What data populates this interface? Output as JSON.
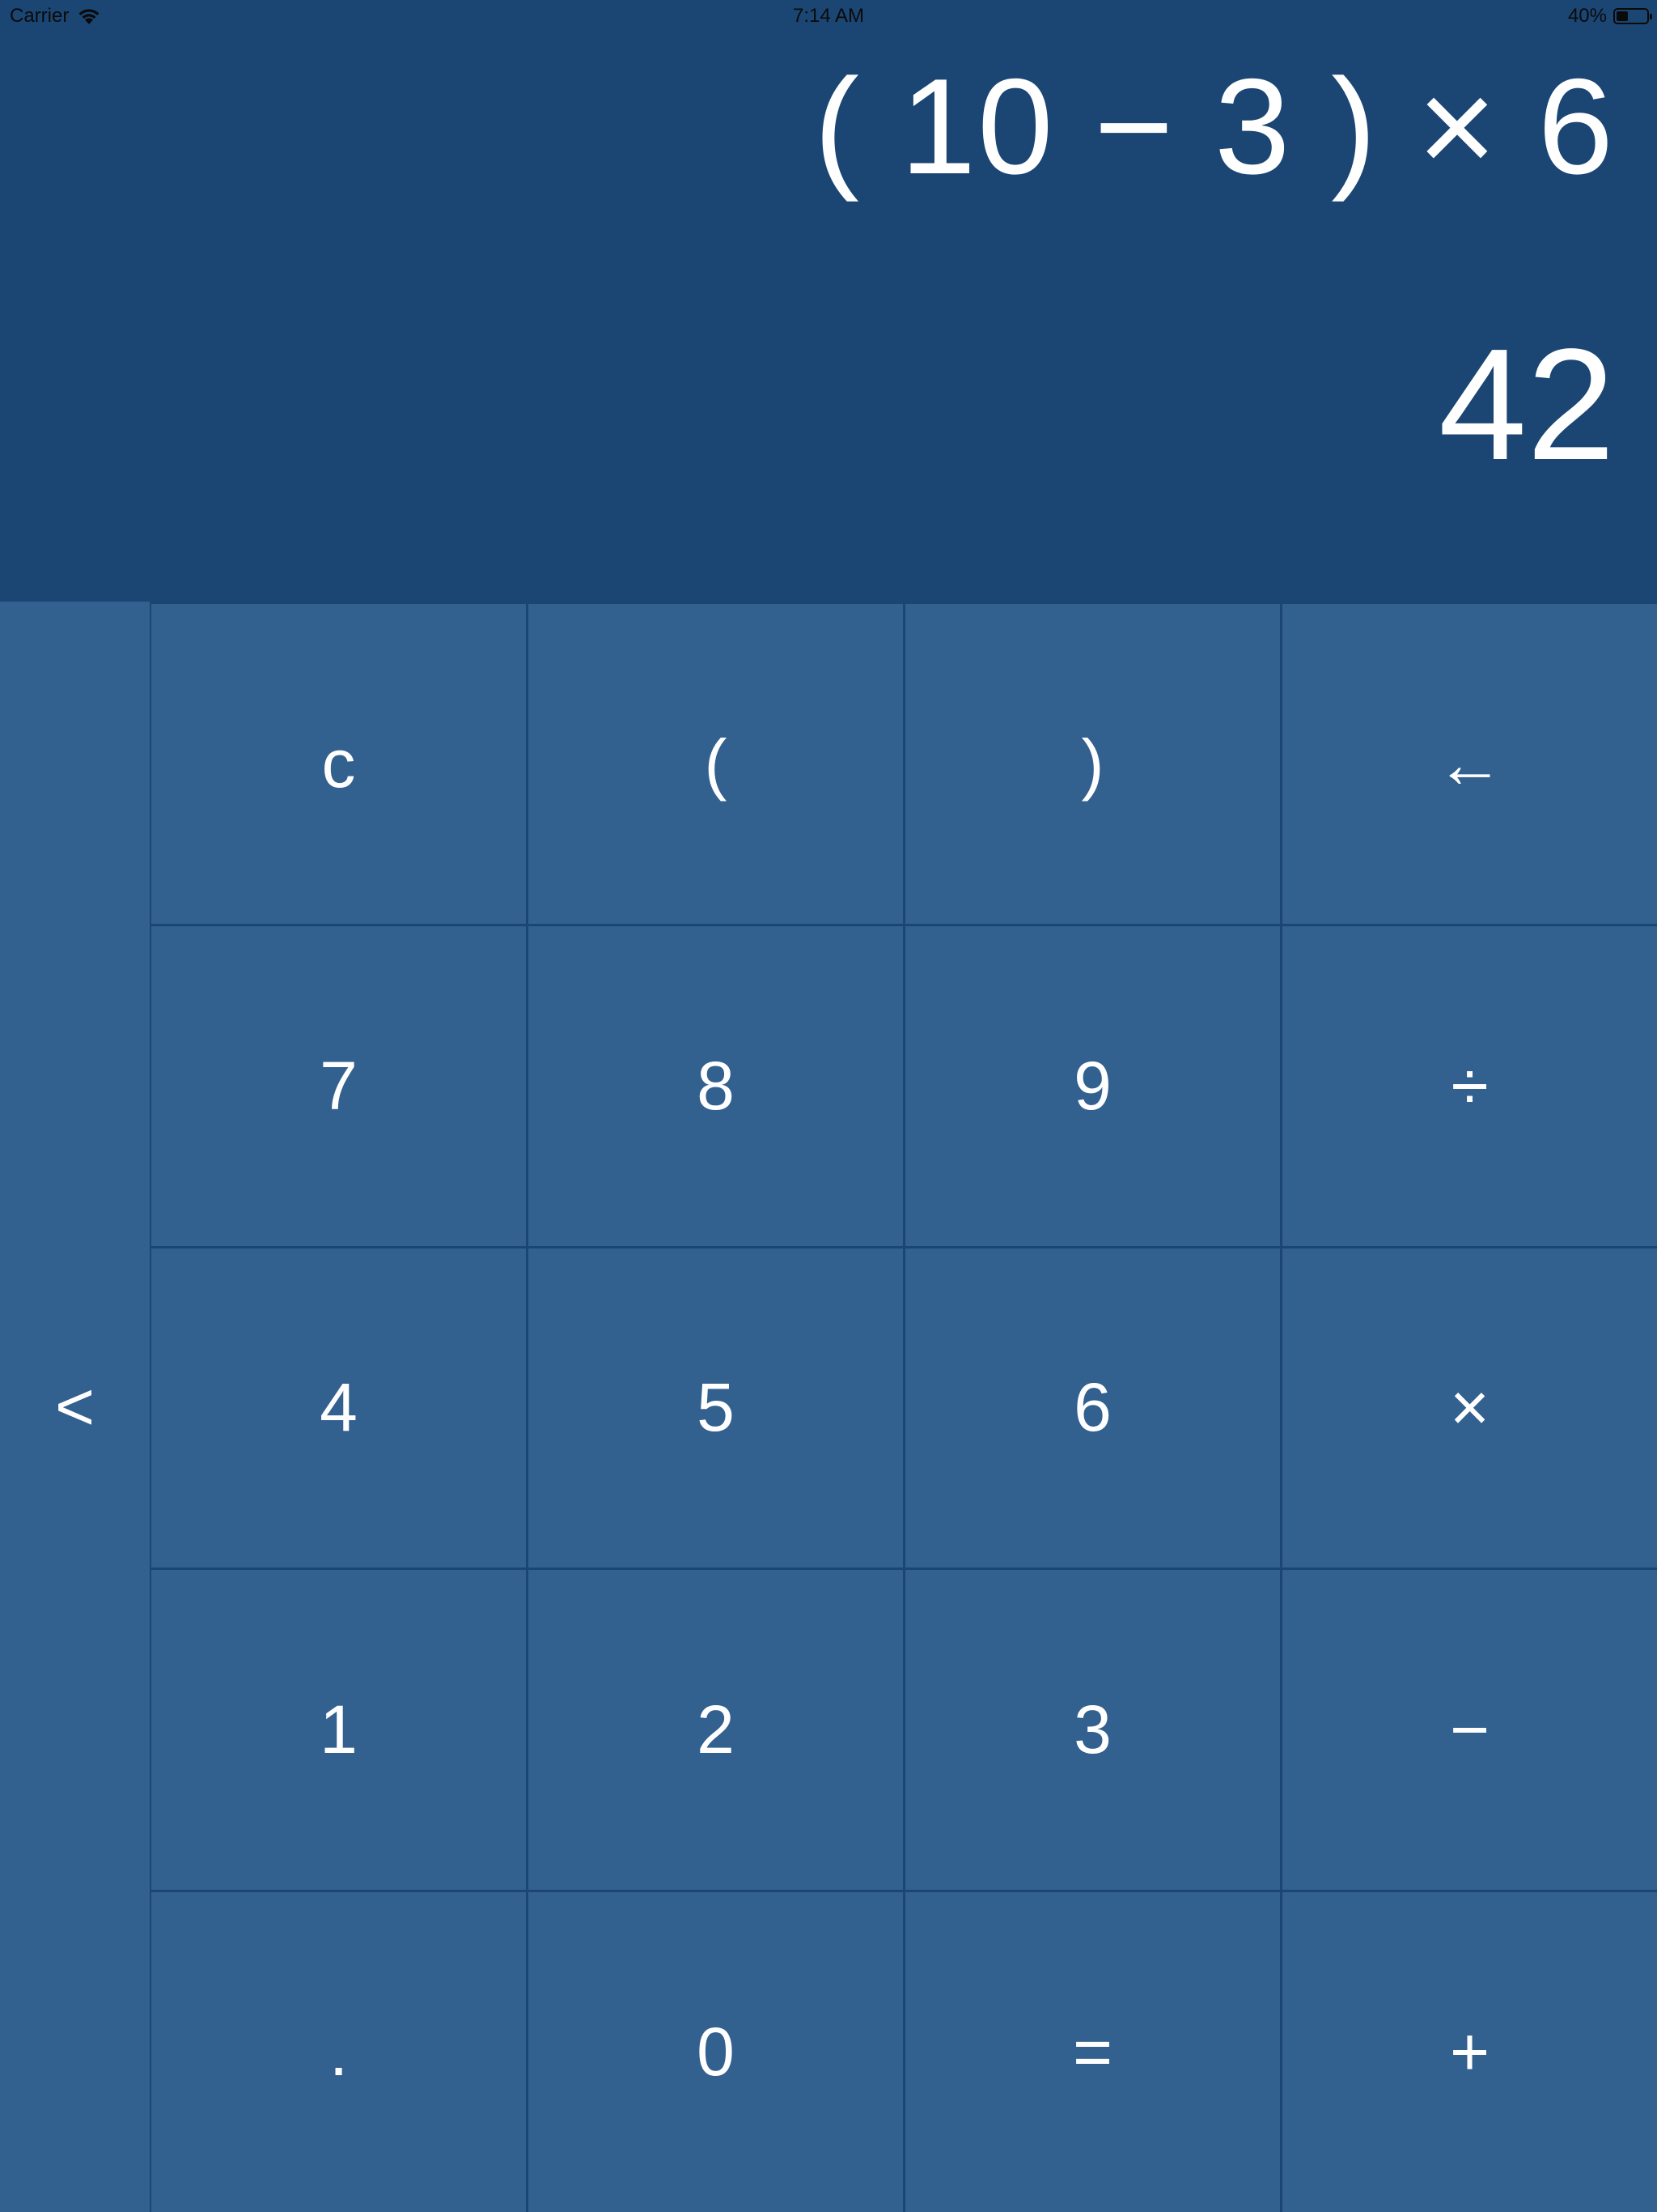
{
  "status_bar": {
    "carrier": "Carrier",
    "time": "7:14 AM",
    "battery_percent": "40%",
    "battery_level": 0.4,
    "icons": [
      "wifi-icon",
      "battery-icon"
    ]
  },
  "display": {
    "expression": "( 10 − 3 ) × 6",
    "result": "42"
  },
  "keypad": {
    "side_toggle_label": "<",
    "rows": [
      [
        {
          "name": "clear-button",
          "label": "c"
        },
        {
          "name": "open-paren-button",
          "label": "("
        },
        {
          "name": "close-paren-button",
          "label": ")"
        },
        {
          "name": "backspace-button",
          "label": "←"
        }
      ],
      [
        {
          "name": "digit-7-button",
          "label": "7"
        },
        {
          "name": "digit-8-button",
          "label": "8"
        },
        {
          "name": "digit-9-button",
          "label": "9"
        },
        {
          "name": "divide-button",
          "label": "÷"
        }
      ],
      [
        {
          "name": "digit-4-button",
          "label": "4"
        },
        {
          "name": "digit-5-button",
          "label": "5"
        },
        {
          "name": "digit-6-button",
          "label": "6"
        },
        {
          "name": "multiply-button",
          "label": "×"
        }
      ],
      [
        {
          "name": "digit-1-button",
          "label": "1"
        },
        {
          "name": "digit-2-button",
          "label": "2"
        },
        {
          "name": "digit-3-button",
          "label": "3"
        },
        {
          "name": "subtract-button",
          "label": "−"
        }
      ],
      [
        {
          "name": "decimal-button",
          "label": "."
        },
        {
          "name": "digit-0-button",
          "label": "0"
        },
        {
          "name": "equals-button",
          "label": "="
        },
        {
          "name": "add-button",
          "label": "+"
        }
      ]
    ]
  },
  "colors": {
    "display_background": "#1b4673",
    "key_background": "#32608f",
    "text": "#ffffff",
    "status_text": "#0a0a0a"
  }
}
